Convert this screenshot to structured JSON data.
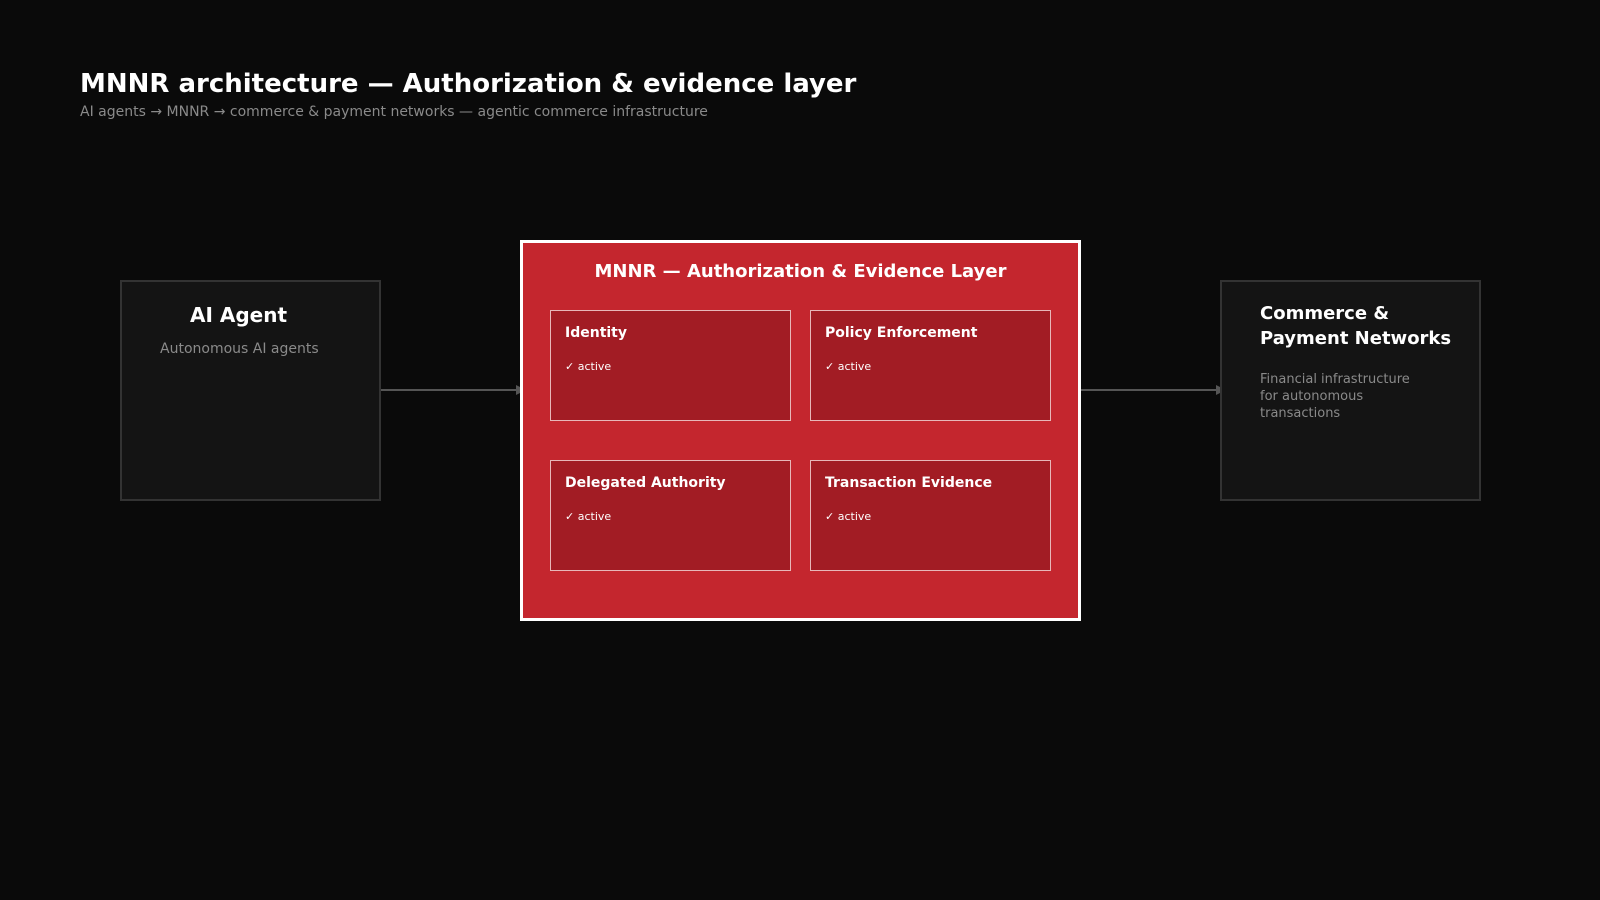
{
  "header": {
    "title": "MNNR architecture — Authorization & evidence layer",
    "subtitle": "AI agents → MNNR → commerce & payment networks — agentic commerce infrastructure"
  },
  "agent": {
    "title": "AI Agent",
    "description": "Autonomous AI agents"
  },
  "layer": {
    "title": "MNNR — Authorization & Evidence Layer",
    "modules": [
      {
        "name": "Identity",
        "status": "✓ active"
      },
      {
        "name": "Policy Enforcement",
        "status": "✓ active"
      },
      {
        "name": "Delegated Authority",
        "status": "✓ active"
      },
      {
        "name": "Transaction Evidence",
        "status": "✓ active"
      }
    ]
  },
  "network": {
    "title": "Commerce & Payment Networks",
    "description": "Financial infrastructure for autonomous transactions"
  },
  "colors": {
    "background": "#0a0a0a",
    "accent": "#c4262e",
    "module_fill": "#a21c24",
    "side_box": "#141414",
    "muted_text": "#8a8a8a"
  }
}
